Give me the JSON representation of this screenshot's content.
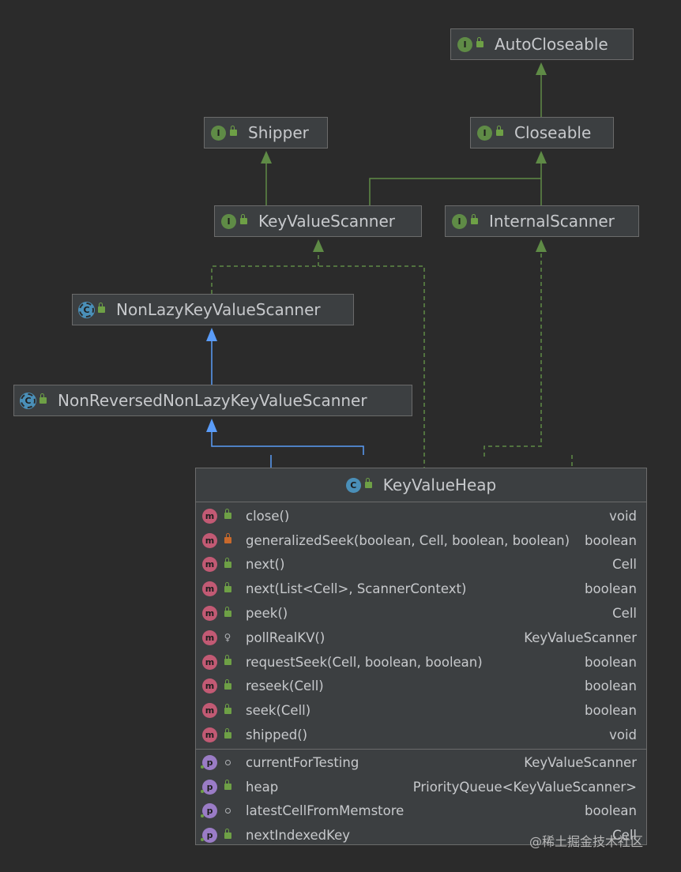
{
  "colors": {
    "background": "#2b2b2b",
    "node_fill": "#3c3f41",
    "node_border": "#6b6b6b",
    "interface_badge": "#5f8b46",
    "class_badge": "#4a8fb8",
    "method_badge": "#c25a74",
    "property_badge": "#9a7cc6",
    "implements_edge": "#5f8b46",
    "extends_edge": "#5a9cf8"
  },
  "nodes": {
    "auto_closeable": {
      "label": "AutoCloseable",
      "badge": "I",
      "kind": "interface"
    },
    "closeable": {
      "label": "Closeable",
      "badge": "I",
      "kind": "interface"
    },
    "shipper": {
      "label": "Shipper",
      "badge": "I",
      "kind": "interface"
    },
    "key_value_scanner": {
      "label": "KeyValueScanner",
      "badge": "I",
      "kind": "interface"
    },
    "internal_scanner": {
      "label": "InternalScanner",
      "badge": "I",
      "kind": "interface"
    },
    "non_lazy": {
      "label": "NonLazyKeyValueScanner",
      "badge": "C",
      "kind": "abstract-class"
    },
    "non_reversed": {
      "label": "NonReversedNonLazyKeyValueScanner",
      "badge": "C",
      "kind": "abstract-class"
    }
  },
  "key_value_heap": {
    "title": "KeyValueHeap",
    "badge": "C",
    "methods": [
      {
        "badge": "m",
        "visibility": "public",
        "name": "close()",
        "type": "void"
      },
      {
        "badge": "m",
        "visibility": "private",
        "name": "generalizedSeek(boolean, Cell, boolean, boolean)",
        "type": "boolean"
      },
      {
        "badge": "m",
        "visibility": "public",
        "name": "next()",
        "type": "Cell"
      },
      {
        "badge": "m",
        "visibility": "public",
        "name": "next(List<Cell>, ScannerContext)",
        "type": "boolean"
      },
      {
        "badge": "m",
        "visibility": "public",
        "name": "peek()",
        "type": "Cell"
      },
      {
        "badge": "m",
        "visibility": "protected",
        "name": "pollRealKV()",
        "type": "KeyValueScanner"
      },
      {
        "badge": "m",
        "visibility": "public",
        "name": "requestSeek(Cell, boolean, boolean)",
        "type": "boolean"
      },
      {
        "badge": "m",
        "visibility": "public",
        "name": "reseek(Cell)",
        "type": "boolean"
      },
      {
        "badge": "m",
        "visibility": "public",
        "name": "seek(Cell)",
        "type": "boolean"
      },
      {
        "badge": "m",
        "visibility": "public",
        "name": "shipped()",
        "type": "void"
      }
    ],
    "fields": [
      {
        "badge": "p",
        "visibility": "package",
        "name": "currentForTesting",
        "type": "KeyValueScanner"
      },
      {
        "badge": "p",
        "visibility": "public",
        "name": "heap",
        "type": "PriorityQueue<KeyValueScanner>"
      },
      {
        "badge": "p",
        "visibility": "package",
        "name": "latestCellFromMemstore",
        "type": "boolean"
      },
      {
        "badge": "p",
        "visibility": "public",
        "name": "nextIndexedKey",
        "type": "Cell"
      }
    ]
  },
  "watermark": "@稀土掘金技术社区"
}
